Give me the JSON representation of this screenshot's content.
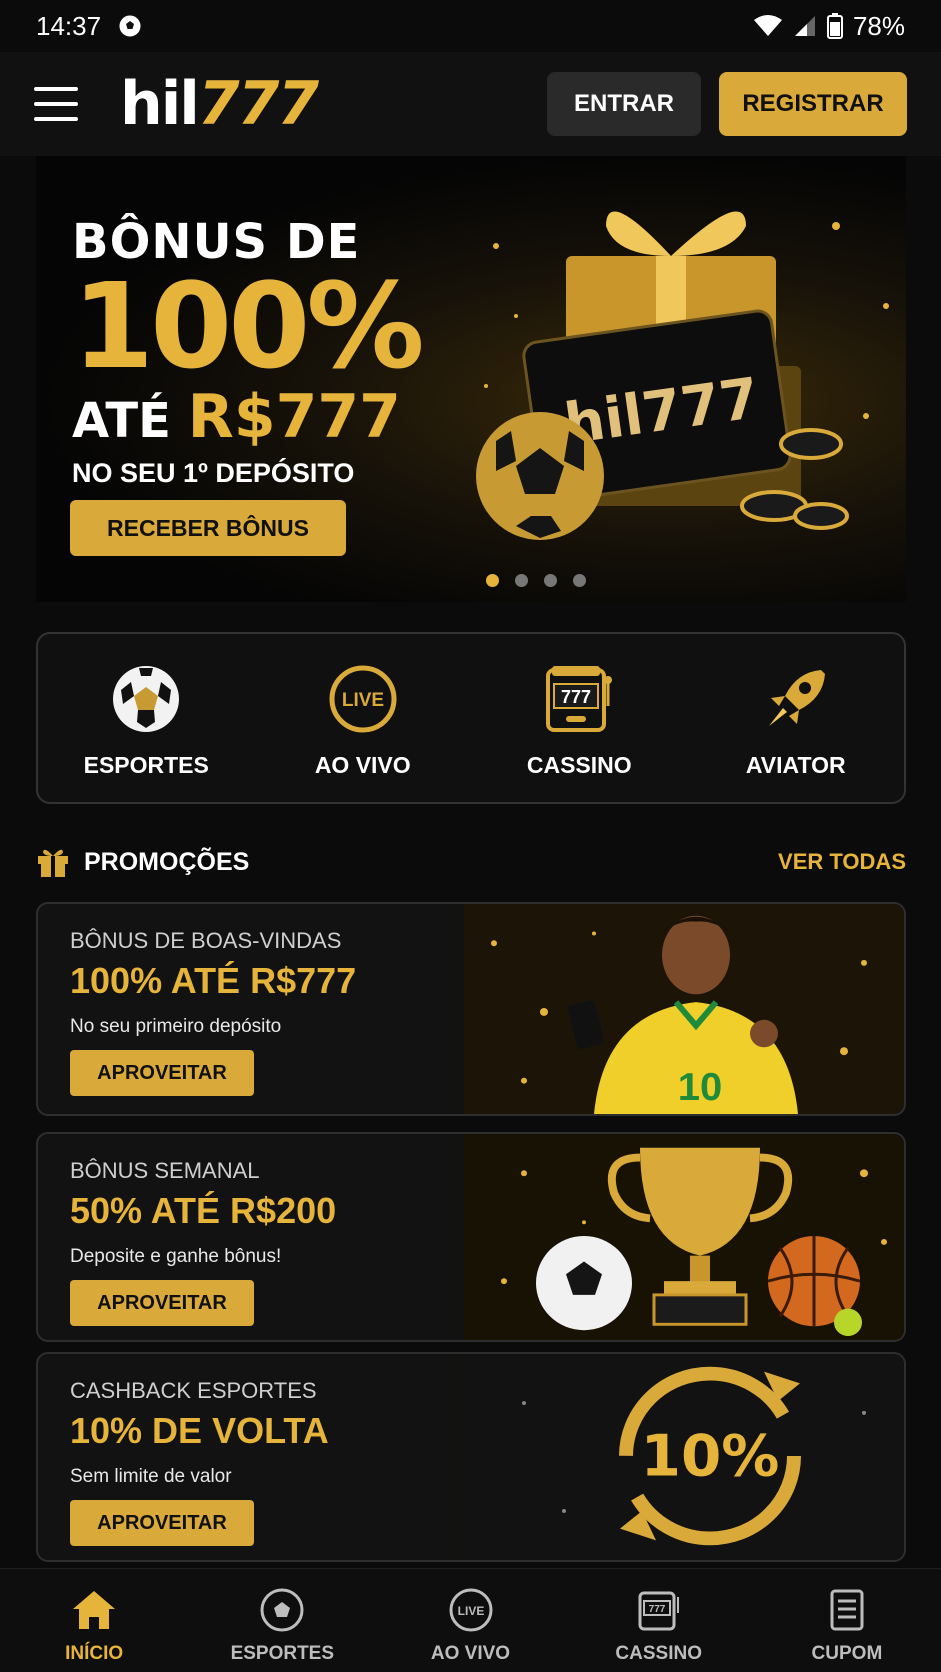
{
  "status_bar": {
    "time": "14:37",
    "battery": "78%"
  },
  "header": {
    "logo_white": "hil",
    "logo_gold": "777",
    "login_label": "ENTRAR",
    "register_label": "REGISTRAR"
  },
  "banner": {
    "line1": "BÔNUS DE",
    "line2": "100%",
    "line3_prefix": "ATÉ ",
    "line3_value": "R$777",
    "line4": "NO SEU 1º DEPÓSITO",
    "cta": "RECEBER BÔNUS",
    "box_logo": "hil777",
    "slides_total": 4,
    "slide_active": 1
  },
  "categories": [
    {
      "label": "ESPORTES",
      "icon": "soccer-ball-icon"
    },
    {
      "label": "AO VIVO",
      "icon": "live-icon"
    },
    {
      "label": "CASSINO",
      "icon": "slot-machine-icon"
    },
    {
      "label": "AVIATOR",
      "icon": "rocket-icon"
    }
  ],
  "promotions": {
    "title": "PROMOÇÕES",
    "see_all": "VER TODAS",
    "items": [
      {
        "subtitle": "BÔNUS DE BOAS-VINDAS",
        "headline": "100% ATÉ R$777",
        "description": "No seu primeiro depósito",
        "cta": "APROVEITAR",
        "image": "soccer-player"
      },
      {
        "subtitle": "BÔNUS SEMANAL",
        "headline": "50% ATÉ R$200",
        "description": "Deposite e ganhe bônus!",
        "cta": "APROVEITAR",
        "image": "trophy-balls"
      },
      {
        "subtitle": "CASHBACK ESPORTES",
        "headline": "10% DE VOLTA",
        "description": "Sem limite de valor",
        "cta": "APROVEITAR",
        "image": "cashback-ring",
        "badge": "10%"
      }
    ]
  },
  "bottom_nav": [
    {
      "label": "INÍCIO",
      "icon": "home-icon",
      "active": true
    },
    {
      "label": "ESPORTES",
      "icon": "soccer-ball-icon",
      "active": false
    },
    {
      "label": "AO VIVO",
      "icon": "live-icon",
      "active": false
    },
    {
      "label": "CASSINO",
      "icon": "slot-machine-icon",
      "active": false
    },
    {
      "label": "CUPOM",
      "icon": "coupon-icon",
      "active": false
    }
  ],
  "colors": {
    "gold": "#e6b43a",
    "button_gold": "#d9a93a",
    "background": "#0b0b0b"
  }
}
